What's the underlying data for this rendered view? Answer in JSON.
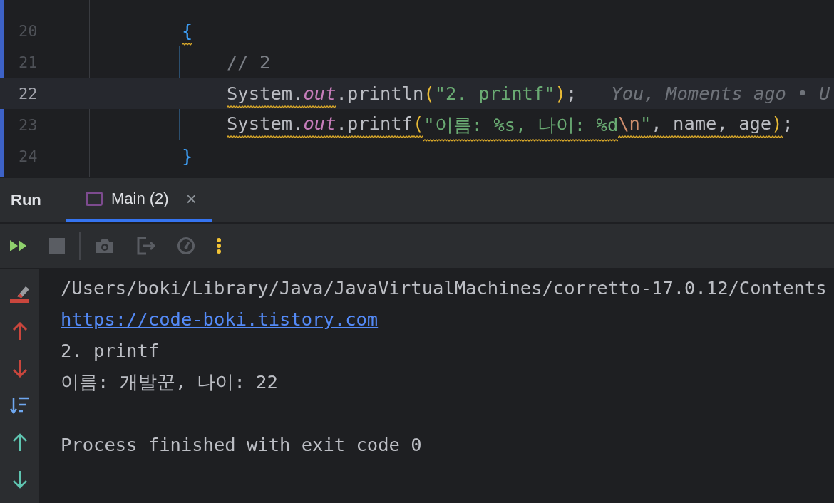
{
  "editor": {
    "lines": [
      {
        "number": "20",
        "current": false,
        "tokens": [
          {
            "text": "{",
            "kind": "brace",
            "warning": true
          }
        ],
        "children": [
          {
            "number": "21",
            "current": false,
            "tokens": [
              {
                "text": "// 2",
                "kind": "comment",
                "warning": false
              }
            ]
          },
          {
            "number": "22",
            "current": true,
            "tokens": [
              {
                "text": "System.",
                "kind": "plain",
                "warning": true
              },
              {
                "text": "out",
                "kind": "field",
                "warning": true
              },
              {
                "text": ".println",
                "kind": "plain",
                "warning": false
              },
              {
                "text": "(",
                "kind": "paren",
                "warning": false
              },
              {
                "text": "\"2. printf\"",
                "kind": "string",
                "warning": false
              },
              {
                "text": ")",
                "kind": "paren",
                "warning": false
              },
              {
                "text": ";",
                "kind": "plain",
                "warning": false
              }
            ],
            "inlay": "You, Moments ago • U"
          },
          {
            "number": "23",
            "current": false,
            "tokens": [
              {
                "text": "System.",
                "kind": "plain",
                "warning": true
              },
              {
                "text": "out",
                "kind": "field",
                "warning": true
              },
              {
                "text": ".printf",
                "kind": "plain",
                "warning": true
              },
              {
                "text": "(",
                "kind": "paren",
                "warning": true
              },
              {
                "text": "\"이름: %s, 나이: %d",
                "kind": "string",
                "warning": true
              },
              {
                "text": "\\n",
                "kind": "escape",
                "warning": true
              },
              {
                "text": "\"",
                "kind": "string",
                "warning": true
              },
              {
                "text": ", name, age",
                "kind": "plain",
                "warning": true
              },
              {
                "text": ")",
                "kind": "paren",
                "warning": true
              },
              {
                "text": ";",
                "kind": "plain",
                "warning": false
              }
            ]
          }
        ]
      },
      {
        "number": "24",
        "current": false,
        "tokens": [
          {
            "text": "}",
            "kind": "brace",
            "warning": false
          }
        ]
      }
    ]
  },
  "run_panel": {
    "title": "Run",
    "tabs": [
      {
        "label": "Main (2)",
        "selected": true,
        "close": "×"
      }
    ]
  },
  "console": {
    "lines": [
      {
        "text": "/Users/boki/Library/Java/JavaVirtualMachines/corretto-17.0.12/Contents",
        "kind": "plain"
      },
      {
        "text": "https://code-boki.tistory.com",
        "kind": "link"
      },
      {
        "text": "2. printf",
        "kind": "plain"
      },
      {
        "text": "이름: 개발꾼, 나이: 22",
        "kind": "plain"
      },
      {
        "text": "Process finished with exit code 0",
        "kind": "spaced"
      }
    ]
  }
}
